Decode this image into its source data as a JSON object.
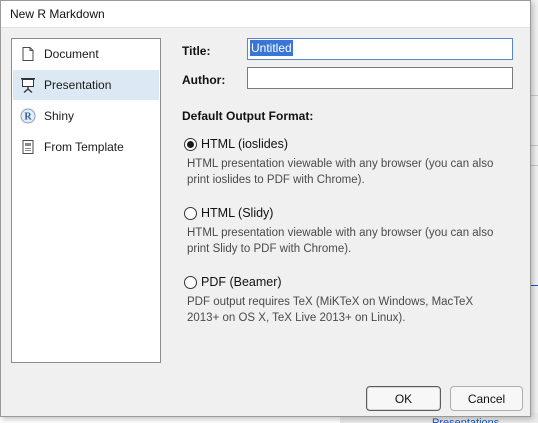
{
  "dialog": {
    "title": "New R Markdown"
  },
  "sidebar": {
    "items": [
      {
        "label": "Document",
        "icon": "document-icon",
        "selected": false
      },
      {
        "label": "Presentation",
        "icon": "presentation-icon",
        "selected": true
      },
      {
        "label": "Shiny",
        "icon": "shiny-r-icon",
        "selected": false
      },
      {
        "label": "From Template",
        "icon": "template-icon",
        "selected": false
      }
    ]
  },
  "form": {
    "title_label": "Title:",
    "title_value": "Untitled",
    "author_label": "Author:",
    "author_value": "",
    "format_heading": "Default Output Format:"
  },
  "formats": [
    {
      "label": "HTML (ioslides)",
      "checked": true,
      "desc1": "HTML presentation viewable with any browser (you can also",
      "desc2": "print ioslides to PDF with Chrome)."
    },
    {
      "label": "HTML (Slidy)",
      "checked": false,
      "desc1": "HTML presentation viewable with any browser (you can also",
      "desc2": "print Slidy to PDF with Chrome)."
    },
    {
      "label": "PDF (Beamer)",
      "checked": false,
      "desc1": "PDF output requires TeX (MiKTeX on Windows, MacTeX",
      "desc2": "2013+ on OS X, TeX Live 2013+ on Linux)."
    }
  ],
  "buttons": {
    "ok": "OK",
    "cancel": "Cancel"
  },
  "background": {
    "link_text": "Presentations"
  },
  "colors": {
    "selected_bg": "#dce9f4",
    "text_selection": "#3875d7",
    "dialog_bg": "#f0f0f0"
  }
}
